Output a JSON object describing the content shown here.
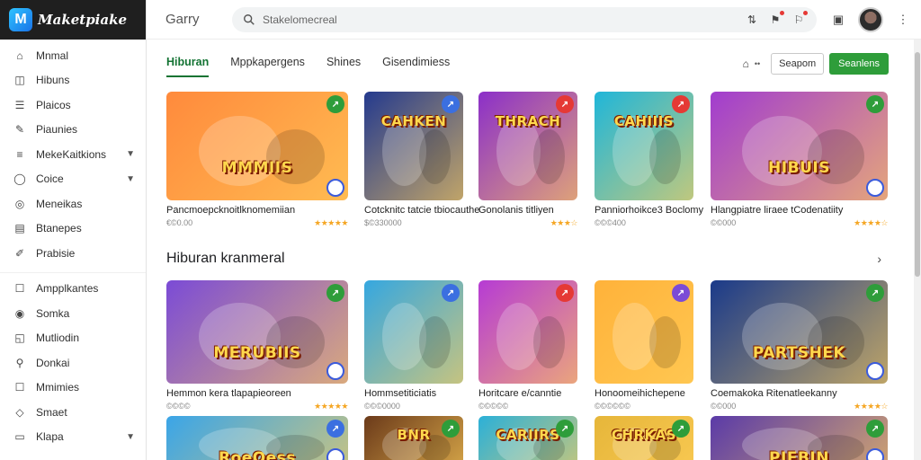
{
  "app": {
    "logo_text": "Maketpiake",
    "title": "Garry"
  },
  "search": {
    "value": "Stakelomecreal"
  },
  "sidebar": {
    "items": [
      {
        "label": "Mnmal",
        "icon": "home-icon",
        "chevron": false
      },
      {
        "label": "Hibuns",
        "icon": "bag-icon",
        "chevron": false
      },
      {
        "label": "Plaicos",
        "icon": "list-icon",
        "chevron": false
      },
      {
        "label": "Piaunies",
        "icon": "pen-icon",
        "chevron": false
      },
      {
        "label": "MekeKaitkions",
        "icon": "menu-icon",
        "chevron": true
      },
      {
        "label": "Coice",
        "icon": "circle-icon",
        "chevron": true
      },
      {
        "label": "Meneikas",
        "icon": "target-icon",
        "chevron": false
      },
      {
        "label": "Btanepes",
        "icon": "box-icon",
        "chevron": false
      },
      {
        "label": "Prabisie",
        "icon": "edit-icon",
        "chevron": false
      },
      {
        "label": "Ampplkantes",
        "icon": "square-icon",
        "chevron": false
      },
      {
        "label": "Somka",
        "icon": "circle-dot-icon",
        "chevron": false
      },
      {
        "label": "Mutliodin",
        "icon": "chart-icon",
        "chevron": false
      },
      {
        "label": "Donkai",
        "icon": "search-icon",
        "chevron": false
      },
      {
        "label": "Mmimies",
        "icon": "square-icon",
        "chevron": false
      },
      {
        "label": "Smaet",
        "icon": "tag-icon",
        "chevron": false
      },
      {
        "label": "Klapa",
        "icon": "folder-icon",
        "chevron": true
      }
    ]
  },
  "tabs": [
    "Hiburan",
    "Mppkapergens",
    "Shines",
    "Gisendimiess"
  ],
  "actions": {
    "small_text": "••",
    "outline_button": "Seapom",
    "green_button": "Seanlens"
  },
  "section": {
    "title": "Hiburan kranmeral"
  },
  "row1": [
    {
      "title": "Pancmoepcknoitlknomemiian",
      "meta": "€©0.00",
      "stars": "★★★★★",
      "art": "MMMIIS",
      "bg": "#ff8a3c",
      "badge": "#2e9d3a"
    },
    {
      "title": "Cotcknitc tatcie tbiocauthe",
      "meta": "$©330000",
      "stars": "",
      "art": "CAHKEN",
      "bg": "#243a8e",
      "badge": "#3b6fe0"
    },
    {
      "title": "Gonolanis titliyen",
      "meta": "",
      "stars": "★★★☆",
      "art": "THRACH",
      "bg": "#8b2fc9",
      "badge": "#e53935"
    },
    {
      "title": "Panniorhoikce3 Boclomy",
      "meta": "©©©400",
      "stars": "",
      "art": "CAHIIIS",
      "bg": "#1fb6d9",
      "badge": "#e53935"
    },
    {
      "title": "Hlangpiatre liraee tCodenatiity",
      "meta": "©©000",
      "stars": "★★★★☆",
      "art": "HIBUIS",
      "bg": "#a13ccf",
      "badge": "#2e9d3a"
    }
  ],
  "row2": [
    {
      "title": "Hemmon kera tlapapieoreen",
      "meta": "©©©©",
      "stars": "★★★★★",
      "art": "MERUBIIS",
      "bg": "#7b4bd6",
      "badge": "#2e9d3a"
    },
    {
      "title": "Hommsetiticiatis",
      "meta": "©©©0000",
      "stars": "",
      "art": "",
      "bg": "#35a7e0",
      "badge": "#3b6fe0"
    },
    {
      "title": "Horitcare e/canntie",
      "meta": "©©©©©",
      "stars": "",
      "art": "",
      "bg": "#b63bd4",
      "badge": "#e53935"
    },
    {
      "title": "Honoomeihichepene",
      "meta": "©©©©©©",
      "stars": "",
      "art": "",
      "bg": "#ffb23a",
      "badge": "#7b4bd6"
    },
    {
      "title": "Coemakoka Ritenatleekanny",
      "meta": "©©000",
      "stars": "★★★★☆",
      "art": "PARTSHEK",
      "bg": "#1a3a8a",
      "badge": "#2e9d3a"
    }
  ],
  "row3": [
    {
      "art": "RoeOess",
      "bg": "#3aa5e8",
      "badge": "#3b6fe0"
    },
    {
      "art": "BNR",
      "bg": "#6b3a1a",
      "badge": "#2e9d3a"
    },
    {
      "art": "CARIIRS",
      "bg": "#2bb0d8",
      "badge": "#2e9d3a"
    },
    {
      "art": "CHRKAS",
      "bg": "#e6b63a",
      "badge": "#2e9d3a"
    },
    {
      "art": "PIEBIN",
      "bg": "#5a3aa8",
      "badge": "#2e9d3a"
    }
  ]
}
